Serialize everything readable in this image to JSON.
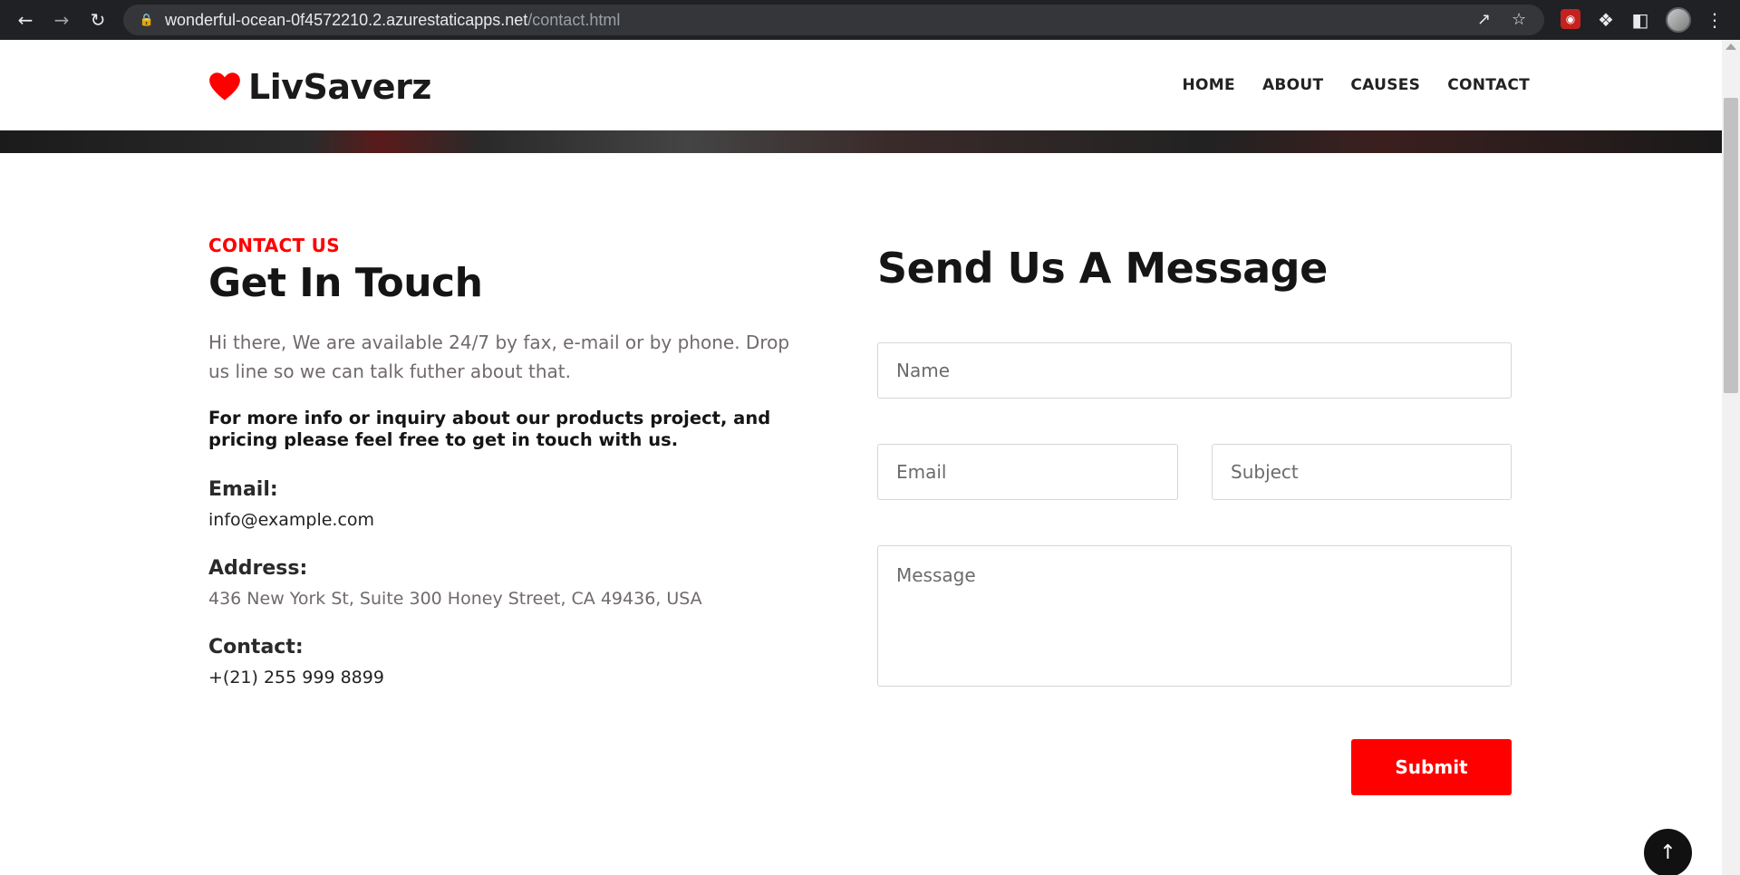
{
  "browser": {
    "url_host": "wonderful-ocean-0f4572210.2.azurestaticapps.net",
    "url_path": "/contact.html"
  },
  "site": {
    "logo_text": "LivSaverz",
    "nav": [
      "HOME",
      "ABOUT",
      "CAUSES",
      "CONTACT"
    ]
  },
  "contact": {
    "eyebrow": "CONTACT US",
    "title": "Get In Touch",
    "lead": "Hi there, We are available 24/7 by fax, e-mail or by phone. Drop us line so we can talk futher about that.",
    "lead_strong": "For more info or inquiry about our products project, and pricing please feel free to get in touch with us.",
    "email_label": "Email:",
    "email_value": "info@example.com",
    "address_label": "Address:",
    "address_value": "436 New York St, Suite 300 Honey Street, CA 49436, USA",
    "contact_label": "Contact:",
    "contact_value": "+(21) 255 999 8899"
  },
  "form": {
    "title": "Send Us A Message",
    "name_placeholder": "Name",
    "email_placeholder": "Email",
    "subject_placeholder": "Subject",
    "message_placeholder": "Message",
    "submit_label": "Submit"
  },
  "icons": {
    "back": "arrow-left-icon",
    "forward": "arrow-right-icon",
    "reload": "reload-icon",
    "lock": "lock-icon",
    "share": "share-icon",
    "bookmark": "star-icon",
    "extensions": "puzzle-icon",
    "side_panel": "side-panel-icon",
    "menu": "kebab-menu-icon",
    "heart": "heart-icon",
    "scroll_top": "arrow-up-icon"
  },
  "colors": {
    "accent": "#ff0000",
    "chrome_bg": "#202124",
    "heading": "#151515",
    "muted_text": "#716a6a"
  }
}
